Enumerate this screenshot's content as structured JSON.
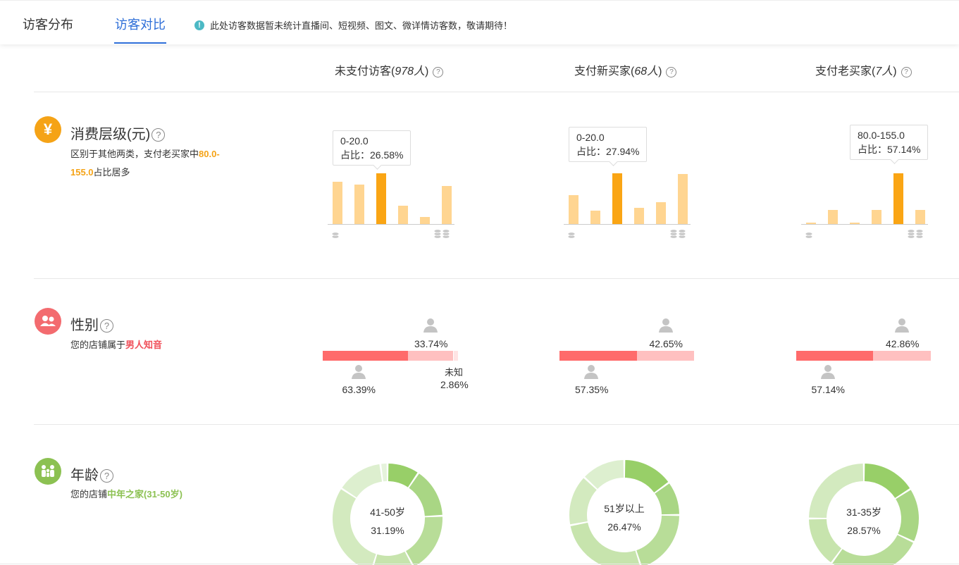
{
  "tabs": [
    {
      "label": "访客分布",
      "active": false
    },
    {
      "label": "访客对比",
      "active": true
    }
  ],
  "notice": "此处访客数据暂未统计直播间、短视频、图文、微详情访客数，敬请期待！",
  "columns": [
    {
      "name": "未支付访客",
      "count": "978人"
    },
    {
      "name": "支付新买家",
      "count": "68人"
    },
    {
      "name": "支付老买家",
      "count": "7人"
    }
  ],
  "sections": {
    "spending": {
      "icon": "yen-icon",
      "title": "消费层级(元)",
      "desc_prefix": "区别于其他两类，支付老买家中",
      "desc_highlight": "80.0-155.0",
      "desc_suffix": "占比居多",
      "color": "#f5a316"
    },
    "gender": {
      "icon": "people-icon",
      "title": "性别",
      "desc_prefix": "您的店铺属于",
      "desc_highlight": "男人知音",
      "color": "#f0505a"
    },
    "age": {
      "icon": "family-icon",
      "title": "年龄",
      "desc_prefix": "您的店铺",
      "desc_highlight": "中年之家(31-50岁)",
      "color": "#8cc152"
    }
  },
  "spending_charts": [
    {
      "tooltip_range": "0-20.0",
      "tooltip_ratio": "占比：26.58%",
      "values": [
        26.58,
        25.0,
        32.0,
        11.5,
        4.5,
        24.0
      ],
      "highlight": 2
    },
    {
      "tooltip_range": "0-20.0",
      "tooltip_ratio": "占比：27.94%",
      "values": [
        16.0,
        7.5,
        27.94,
        9.0,
        12.0,
        27.5
      ],
      "highlight": 2
    },
    {
      "tooltip_range": "80.0-155.0",
      "tooltip_ratio": "占比：57.14%",
      "values": [
        1.5,
        15.5,
        1.5,
        15.5,
        57.14,
        15.5
      ],
      "highlight": 4
    }
  ],
  "gender_charts": [
    {
      "male": "63.39%",
      "female": "33.74%",
      "unknown_label": "未知",
      "unknown": "2.86%",
      "male_frac": 0.6339,
      "female_frac": 0.3374,
      "unknown_frac": 0.0286
    },
    {
      "male": "57.35%",
      "female": "42.65%",
      "male_frac": 0.5735,
      "female_frac": 0.4265,
      "unknown_frac": 0
    },
    {
      "male": "57.14%",
      "female": "42.86%",
      "male_frac": 0.5714,
      "female_frac": 0.4286,
      "unknown_frac": 0
    }
  ],
  "age_charts": [
    {
      "label": "41-50岁",
      "pct": "31.19%",
      "segments": [
        9,
        14,
        17,
        12,
        28,
        13,
        2
      ]
    },
    {
      "label": "51岁以上",
      "pct": "26.47%",
      "segments": [
        15,
        10,
        20,
        27,
        15,
        13
      ]
    },
    {
      "label": "31-35岁",
      "pct": "28.57%",
      "segments": [
        16,
        16,
        28,
        15,
        25
      ]
    }
  ],
  "colors": {
    "bar_light": "#ffd591",
    "bar_highlight": "#faa514",
    "male": "#ff6b6b",
    "female": "#ffc0c0",
    "unknown": "#ffe4e4",
    "donut": [
      "#98cf68",
      "#a9d684",
      "#b8dd98",
      "#c7e4ad",
      "#d3eabf",
      "#ddefcf",
      "#e6f3dc"
    ]
  }
}
